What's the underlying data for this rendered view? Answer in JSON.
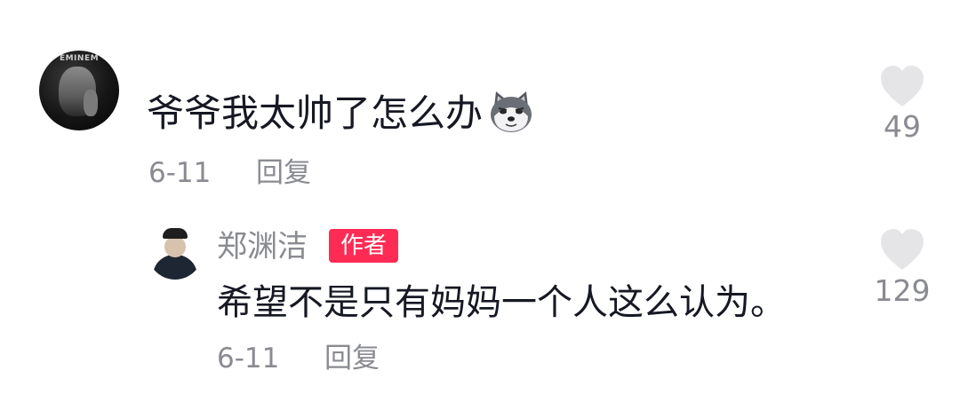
{
  "comment": {
    "text": "爷爷我太帅了怎么办",
    "emoji": "husky-dog-emoji",
    "date": "6-11",
    "reply_label": "回复",
    "likes": "49",
    "avatar_logo": "EMINEM"
  },
  "reply": {
    "author": "郑渊洁",
    "badge": "作者",
    "text": "希望不是只有妈妈一个人这么认为。",
    "date": "6-11",
    "reply_label": "回复",
    "likes": "129"
  },
  "colors": {
    "text": "#161823",
    "secondary": "#8a8b91",
    "badge_bg": "#fe2c55",
    "heart": "#e5e5e7"
  }
}
